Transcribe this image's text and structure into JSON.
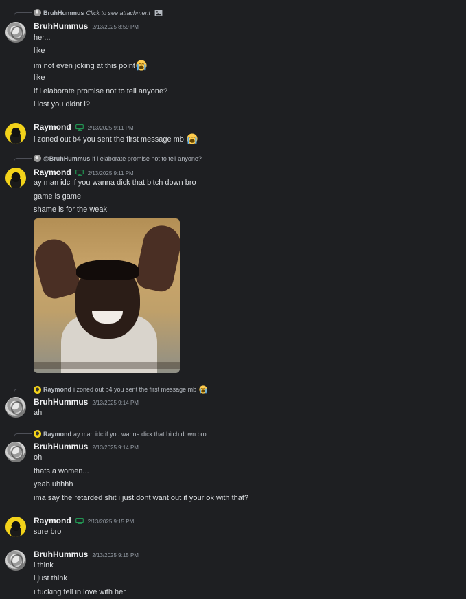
{
  "messages": [
    {
      "reply": {
        "user": "BruhHummus",
        "text": "Click to see attachment"
      },
      "user": "BruhHummus",
      "timestamp": "2/13/2025 8:59 PM",
      "lines": [
        "her...",
        "like",
        "im not even joking at this point",
        "like",
        "if i elaborate promise not to tell anyone?",
        "i lost you didnt i?"
      ]
    },
    {
      "user": "Raymond",
      "timestamp": "2/13/2025 9:11 PM",
      "lines": [
        "i zoned out b4 you sent the first message mb"
      ]
    },
    {
      "reply": {
        "user": "@BruhHummus",
        "text": "if i elaborate promise not to tell anyone?"
      },
      "user": "Raymond",
      "timestamp": "2/13/2025 9:11 PM",
      "lines": [
        "ay man idc if you wanna dick that bitch down bro",
        "game is game",
        "shame is for the weak"
      ]
    },
    {
      "reply": {
        "user": "Raymond",
        "text": "i zoned out b4 you sent the first message mb"
      },
      "user": "BruhHummus",
      "timestamp": "2/13/2025 9:14 PM",
      "lines": [
        "ah"
      ]
    },
    {
      "reply": {
        "user": "Raymond",
        "text": "ay man idc if you wanna dick that bitch down bro"
      },
      "user": "BruhHummus",
      "timestamp": "2/13/2025 9:14 PM",
      "lines": [
        "oh",
        "thats a women...",
        "yeah uhhhh",
        "ima say the retarded shit i just dont want out if your ok with that?"
      ]
    },
    {
      "user": "Raymond",
      "timestamp": "2/13/2025 9:15 PM",
      "lines": [
        "sure bro"
      ]
    },
    {
      "user": "BruhHummus",
      "timestamp": "2/13/2025 9:15 PM",
      "lines": [
        "i think",
        "i just think",
        "i fucking fell in love with her"
      ]
    }
  ],
  "icons": {
    "crying": "loudly-crying-face-emoji",
    "device": "desktop-icon",
    "image": "image-icon"
  },
  "colors": {
    "background": "#1e1f22",
    "username": "#f2f3f5",
    "text": "#dbdee1",
    "timestamp": "#949ba4",
    "desktop_icon": "#23a55a"
  }
}
